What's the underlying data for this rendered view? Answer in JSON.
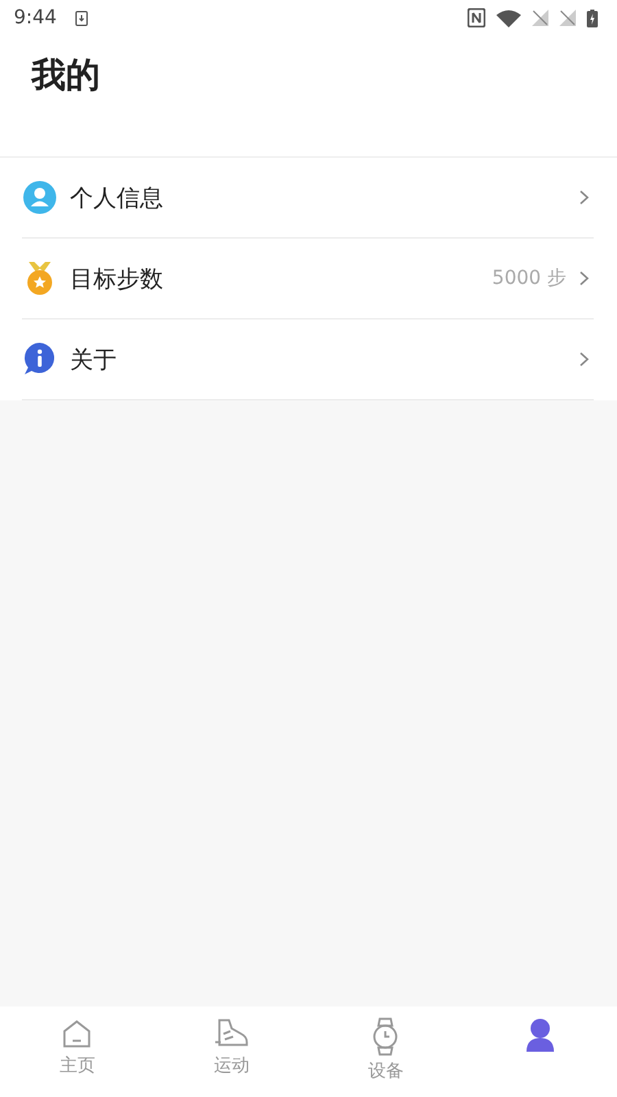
{
  "status_bar": {
    "time": "9:44"
  },
  "header": {
    "title": "我的"
  },
  "menu": [
    {
      "kind": "person",
      "label": "个人信息"
    },
    {
      "kind": "medal",
      "label": "目标步数",
      "value": "5000 步"
    },
    {
      "kind": "info",
      "label": "关于"
    }
  ],
  "tabs": [
    {
      "kind": "home",
      "label": "主页",
      "selected": false
    },
    {
      "kind": "shoe",
      "label": "运动",
      "selected": false
    },
    {
      "kind": "watch",
      "label": "设备",
      "selected": false
    },
    {
      "kind": "user",
      "selected": true
    }
  ]
}
